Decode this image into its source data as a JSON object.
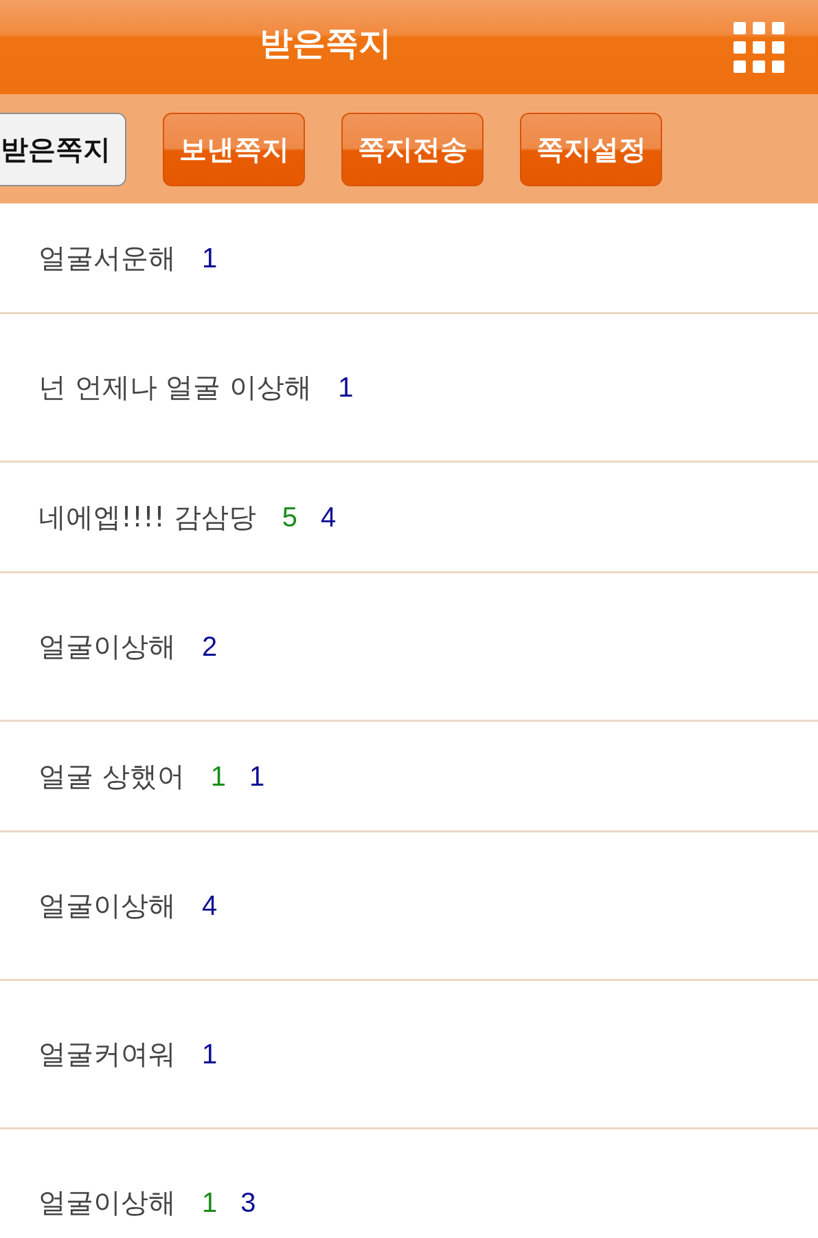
{
  "header": {
    "title": "받은쪽지"
  },
  "tabs": [
    {
      "label": "받은쪽지",
      "selected": true
    },
    {
      "label": "보낸쪽지",
      "selected": false
    },
    {
      "label": "쪽지전송",
      "selected": false
    },
    {
      "label": "쪽지설정",
      "selected": false
    }
  ],
  "messages": [
    {
      "title": "얼굴서운해",
      "counts": [
        {
          "text": "1",
          "color": "#0d0d96"
        }
      ]
    },
    {
      "title": "넌 언제나 얼굴 이상해",
      "counts": [
        {
          "text": "1",
          "color": "#0d0d96"
        }
      ]
    },
    {
      "title": "네에엡!!!! 감삼당",
      "counts": [
        {
          "text": "5",
          "color": "#1a8c1a"
        },
        {
          "text": "4",
          "color": "#0d0d96"
        }
      ]
    },
    {
      "title": "얼굴이상해",
      "counts": [
        {
          "text": "2",
          "color": "#0d0d96"
        }
      ]
    },
    {
      "title": "얼굴 상했어",
      "counts": [
        {
          "text": "1",
          "color": "#1a8c1a"
        },
        {
          "text": "1",
          "color": "#0d0d96"
        }
      ]
    },
    {
      "title": "얼굴이상해",
      "counts": [
        {
          "text": "4",
          "color": "#0d0d96"
        }
      ]
    },
    {
      "title": "얼굴커여워",
      "counts": [
        {
          "text": "1",
          "color": "#0d0d96"
        }
      ]
    },
    {
      "title": "얼굴이상해",
      "counts": [
        {
          "text": "1",
          "color": "#1a8c1a"
        },
        {
          "text": "3",
          "color": "#0d0d96"
        }
      ]
    }
  ]
}
